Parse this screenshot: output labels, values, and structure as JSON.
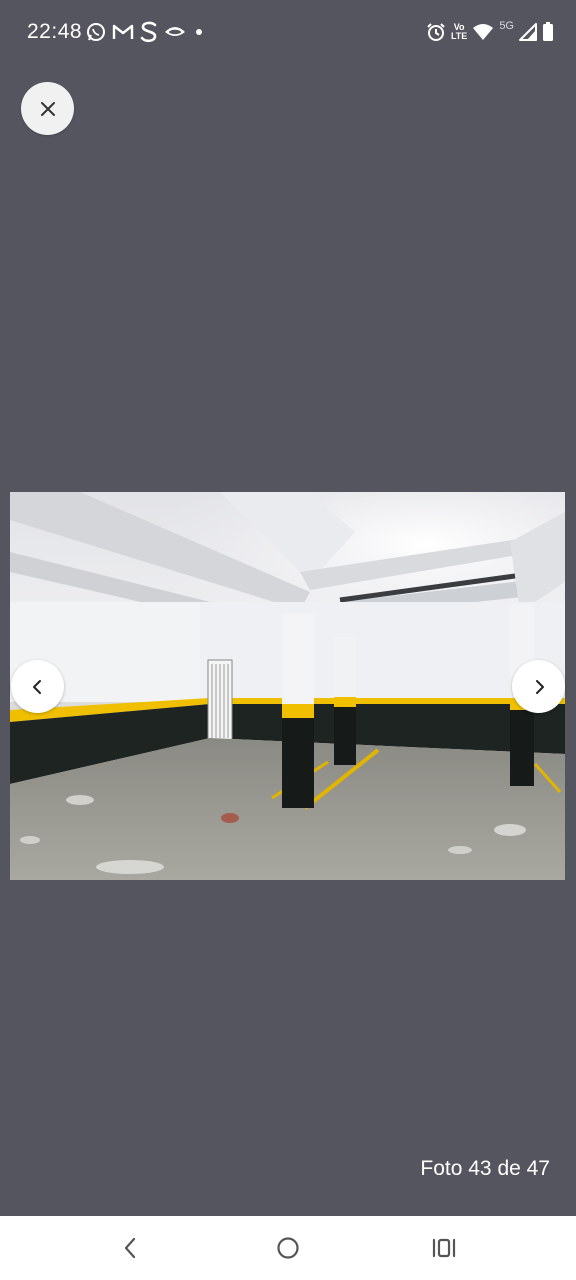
{
  "status_bar": {
    "time": "22:48",
    "left_icons": [
      "whatsapp-icon",
      "gmail-icon",
      "s-app-icon",
      "eye-app-icon",
      "notification-dot-icon"
    ],
    "right_icons": [
      "alarm-icon",
      "volte-icon",
      "wifi-icon",
      "5g-icon",
      "signal-icon",
      "battery-icon"
    ],
    "volte_top": "Vo",
    "volte_bottom": "LTE",
    "network_label": "5G"
  },
  "viewer": {
    "close_icon": "close-icon",
    "prev_icon": "chevron-left-icon",
    "next_icon": "chevron-right-icon",
    "counter": "Foto 43 de 47"
  },
  "system_nav": {
    "icons": [
      "back-icon",
      "home-icon",
      "recents-icon"
    ]
  },
  "colors": {
    "background": "#555560",
    "button_bg": "#f1f1f1",
    "nav_bg": "#ffffff"
  }
}
